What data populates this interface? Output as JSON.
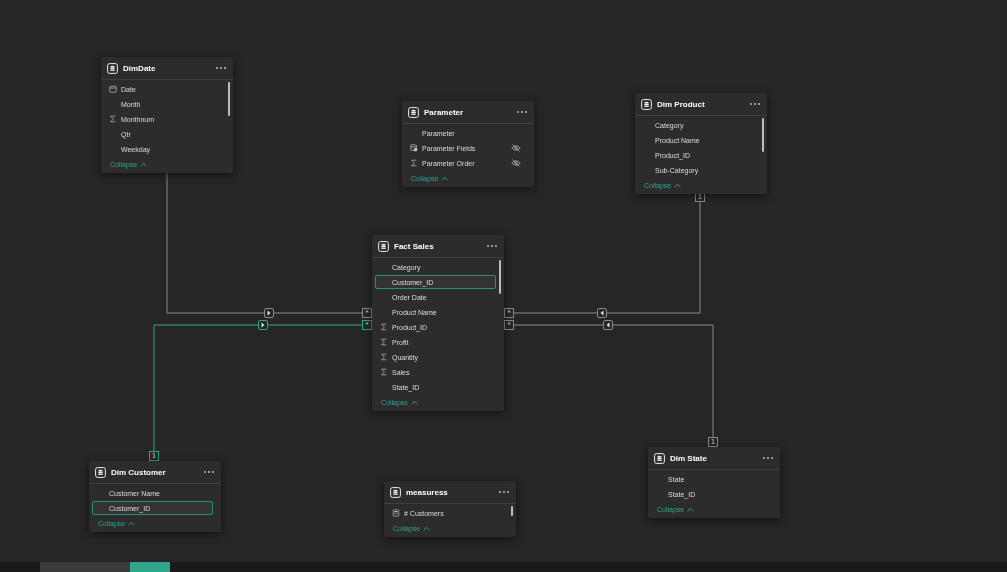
{
  "tables": [
    {
      "title": "DimDate",
      "scrollable": true,
      "collapse": "Collapse",
      "fields": [
        {
          "name": "Date",
          "kind": "calendar",
          "hidden": false,
          "selected": false
        },
        {
          "name": "Month",
          "kind": "plain",
          "hidden": false,
          "selected": false
        },
        {
          "name": "Monthnum",
          "kind": "sum",
          "hidden": false,
          "selected": false
        },
        {
          "name": "Qtr",
          "kind": "plain",
          "hidden": false,
          "selected": false
        },
        {
          "name": "Weekday",
          "kind": "plain",
          "hidden": false,
          "selected": false
        }
      ]
    },
    {
      "title": "Parameter",
      "scrollable": false,
      "collapse": "Collapse",
      "fields": [
        {
          "name": "Parameter",
          "kind": "plain",
          "hidden": false,
          "selected": false
        },
        {
          "name": "Parameter Fields",
          "kind": "parameter",
          "hidden": true,
          "selected": false
        },
        {
          "name": "Parameter Order",
          "kind": "sum",
          "hidden": true,
          "selected": false
        }
      ]
    },
    {
      "title": "Dim Product",
      "scrollable": true,
      "collapse": "Collapse",
      "fields": [
        {
          "name": "Category",
          "kind": "plain",
          "hidden": false,
          "selected": false
        },
        {
          "name": "Product Name",
          "kind": "plain",
          "hidden": false,
          "selected": false
        },
        {
          "name": "Product_ID",
          "kind": "plain",
          "hidden": false,
          "selected": false
        },
        {
          "name": "Sub-Category",
          "kind": "plain",
          "hidden": false,
          "selected": false
        }
      ]
    },
    {
      "title": "Fact Sales",
      "scrollable": true,
      "collapse": "Collapse",
      "fields": [
        {
          "name": "Category",
          "kind": "plain",
          "hidden": false,
          "selected": false
        },
        {
          "name": "Customer_ID",
          "kind": "plain",
          "hidden": false,
          "selected": true
        },
        {
          "name": "Order Date",
          "kind": "plain",
          "hidden": false,
          "selected": false
        },
        {
          "name": "Product Name",
          "kind": "plain",
          "hidden": false,
          "selected": false
        },
        {
          "name": "Product_ID",
          "kind": "sum",
          "hidden": false,
          "selected": false
        },
        {
          "name": "Profit",
          "kind": "sum",
          "hidden": false,
          "selected": false
        },
        {
          "name": "Quantity",
          "kind": "sum",
          "hidden": false,
          "selected": false
        },
        {
          "name": "Sales",
          "kind": "sum",
          "hidden": false,
          "selected": false
        },
        {
          "name": "State_ID",
          "kind": "plain",
          "hidden": false,
          "selected": false
        }
      ]
    },
    {
      "title": "Dim Customer",
      "scrollable": false,
      "collapse": "Collapse",
      "fields": [
        {
          "name": "Customer Name",
          "kind": "plain",
          "hidden": false,
          "selected": false
        },
        {
          "name": "Customer_ID",
          "kind": "plain",
          "hidden": false,
          "selected": true
        }
      ]
    },
    {
      "title": "measuress",
      "scrollable": true,
      "collapse": "Collapse",
      "fields": [
        {
          "name": "# Customers",
          "kind": "measure",
          "hidden": false,
          "selected": false
        }
      ]
    },
    {
      "title": "Dim State",
      "scrollable": false,
      "collapse": "Collapse",
      "fields": [
        {
          "name": "State",
          "kind": "plain",
          "hidden": false,
          "selected": false
        },
        {
          "name": "State_ID",
          "kind": "plain",
          "hidden": false,
          "selected": false
        }
      ]
    }
  ],
  "relationships": [
    {
      "many_label": "*",
      "points_left": false,
      "highlighted": false
    },
    {
      "one_label": "1",
      "many_label": "*",
      "points_left": true,
      "highlighted": false
    },
    {
      "one_label": "1",
      "many_label": "*",
      "points_left": false,
      "highlighted": true
    },
    {
      "one_label": "1",
      "many_label": "*",
      "points_left": true,
      "highlighted": false
    }
  ]
}
